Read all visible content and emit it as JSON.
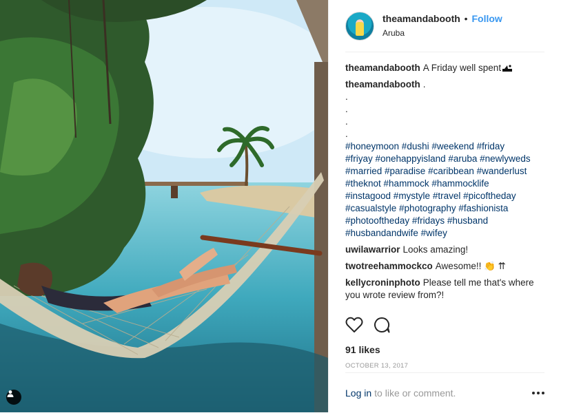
{
  "header": {
    "username": "theamandabooth",
    "separator": "•",
    "follow_label": "Follow",
    "location": "Aruba"
  },
  "caption": {
    "user": "theamandabooth",
    "text": "A Friday well spent",
    "emoji": "beach-icon"
  },
  "follow_up": {
    "user": "theamandabooth",
    "text": "."
  },
  "dot_lines": [
    ".",
    ".",
    ".",
    "."
  ],
  "hashtags": [
    "#honeymoon #dushi #weekend #friday",
    "#friyay #onehappyisland #aruba #newlyweds",
    "#married #paradise #caribbean #wanderlust",
    "#theknot #hammock #hammocklife",
    "#instagood #mystyle #travel #picoftheday",
    "#casualstyle #photography #fashionista",
    "#photooftheday #fridays #husband",
    "#husbandandwife #wifey"
  ],
  "comments": [
    {
      "user": "uwilawarrior",
      "text": "Looks amazing!"
    },
    {
      "user": "twotreehammockco",
      "text": "Awesome!! 👏 ⇈"
    },
    {
      "user": "kellycroninphoto",
      "text": "Please tell me that's where you wrote review from?!"
    }
  ],
  "actions": {
    "like_icon": "heart-icon",
    "comment_icon": "comment-icon",
    "likes_text": "91 likes",
    "date": "OCTOBER 13, 2017"
  },
  "footer": {
    "login_label": "Log in",
    "rest_text": "to like or comment.",
    "more_icon": "more-options-icon"
  },
  "photo": {
    "tag_icon": "user-tag-icon"
  },
  "colors": {
    "link": "#003569",
    "follow": "#3897f0",
    "muted": "#999999"
  }
}
